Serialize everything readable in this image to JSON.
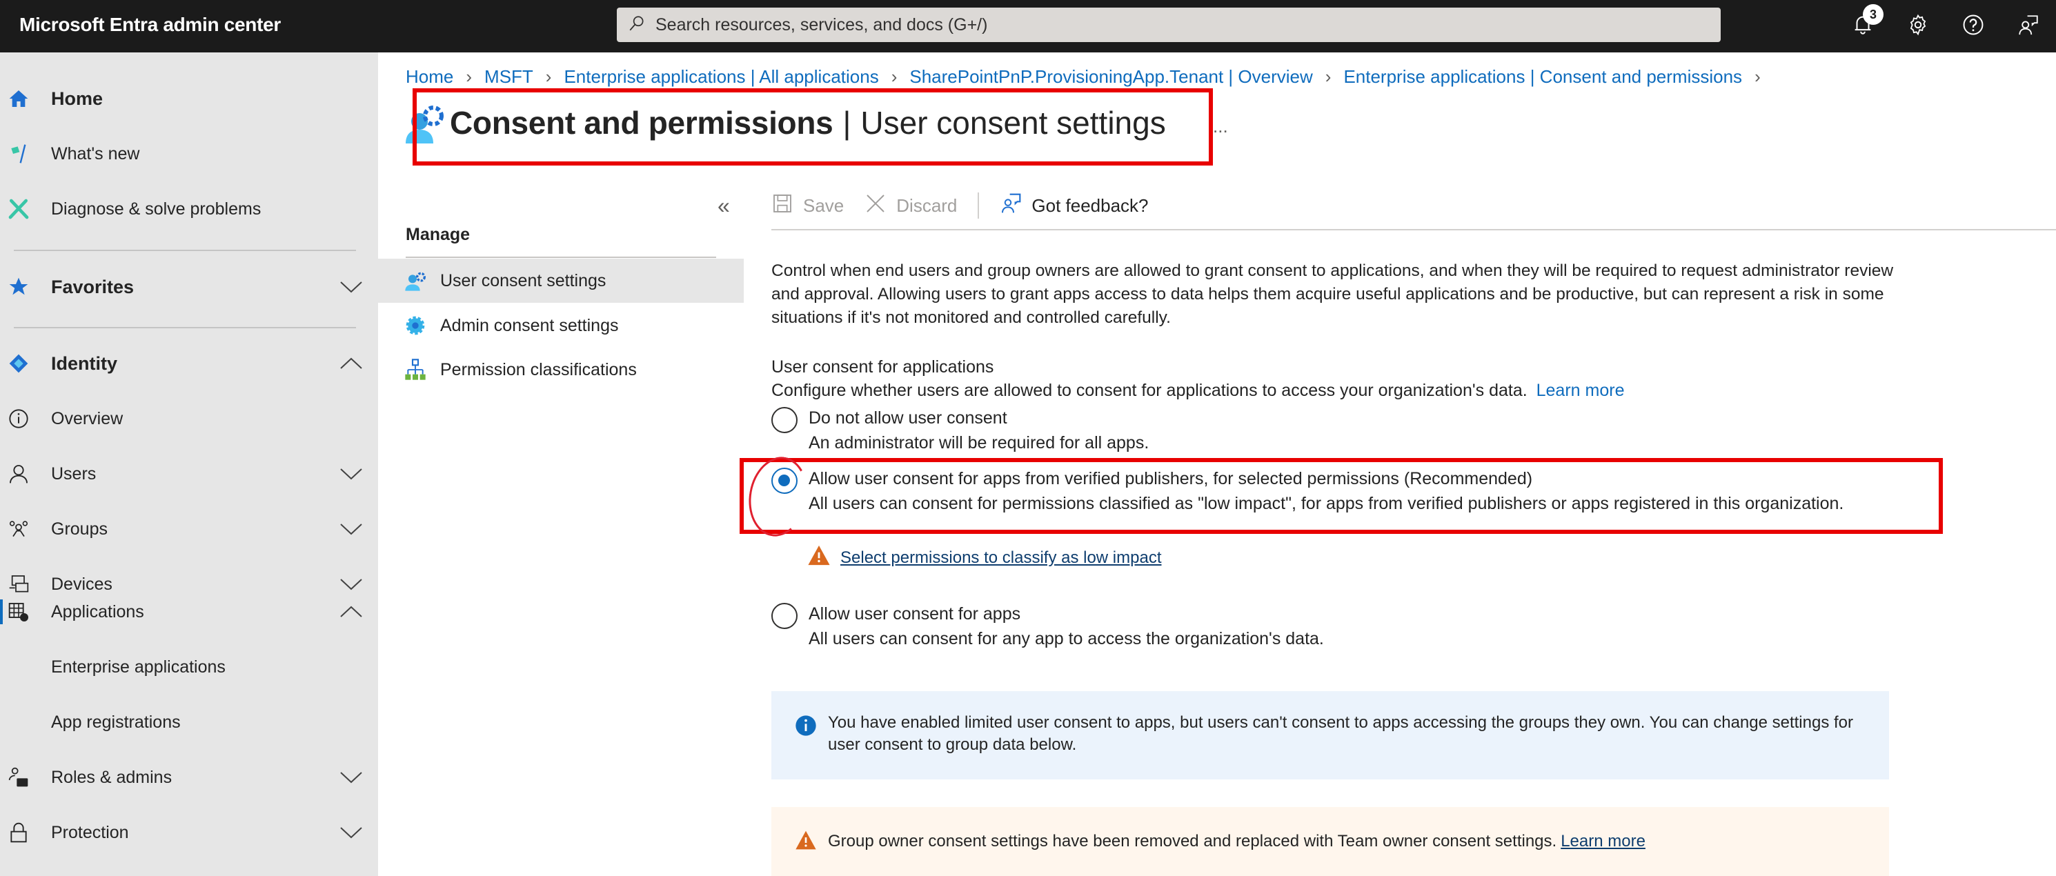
{
  "app": {
    "title": "Microsoft Entra admin center",
    "search_placeholder": "Search resources, services, and docs (G+/)",
    "notification_count": "3"
  },
  "header_icons": [
    "bell-icon",
    "gear-icon",
    "help-icon",
    "feedback-icon"
  ],
  "sidebar": {
    "items": [
      {
        "label": "Home",
        "icon": "home-icon",
        "bold": true
      },
      {
        "label": "What's new",
        "icon": "flag-icon"
      },
      {
        "label": "Diagnose & solve problems",
        "icon": "wrench-icon"
      },
      {
        "label": "Favorites",
        "icon": "star-icon",
        "bold": true,
        "expanded": false
      },
      {
        "label": "Identity",
        "icon": "identity-diamond-icon",
        "bold": true,
        "expanded": true
      },
      {
        "label": "Overview",
        "icon": "info-icon"
      },
      {
        "label": "Users",
        "icon": "user-icon",
        "expanded": false
      },
      {
        "label": "Groups",
        "icon": "groups-icon",
        "expanded": false
      },
      {
        "label": "Devices",
        "icon": "devices-icon",
        "expanded": false
      },
      {
        "label": "Applications",
        "icon": "applications-icon",
        "expanded": true,
        "active": true
      },
      {
        "label": "Enterprise applications"
      },
      {
        "label": "App registrations"
      },
      {
        "label": "Roles & admins",
        "icon": "roles-icon",
        "expanded": false
      },
      {
        "label": "Protection",
        "icon": "lock-icon",
        "expanded": false
      }
    ]
  },
  "breadcrumb": [
    "Home",
    "MSFT",
    "Enterprise applications | All applications",
    "SharePointPnP.ProvisioningApp.Tenant | Overview",
    "Enterprise applications | Consent and permissions"
  ],
  "page": {
    "title_main": "Consent and permissions",
    "title_sep": "|",
    "title_sub": "User consent settings",
    "more": "..."
  },
  "subnav": {
    "collapse": "«",
    "heading": "Manage",
    "items": [
      {
        "label": "User consent settings",
        "selected": true
      },
      {
        "label": "Admin consent settings"
      },
      {
        "label": "Permission classifications"
      }
    ]
  },
  "commands": {
    "save": "Save",
    "discard": "Discard",
    "feedback": "Got feedback?"
  },
  "content": {
    "description": "Control when end users and group owners are allowed to grant consent to applications, and when they will be required to request administrator review and approval. Allowing users to grant apps access to data helps them acquire useful applications and be productive, but can represent a risk in some situations if it's not monitored and controlled carefully.",
    "section_title": "User consent for applications",
    "section_desc": "Configure whether users are allowed to consent for applications to access your organization's data.",
    "learn_more": "Learn more",
    "options": [
      {
        "label": "Do not allow user consent",
        "sub": "An administrator will be required for all apps.",
        "checked": false
      },
      {
        "label": "Allow user consent for apps from verified publishers, for selected permissions (Recommended)",
        "sub": "All users can consent for permissions classified as \"low impact\", for apps from verified publishers or apps registered in this organization.",
        "checked": true
      },
      {
        "label": "Allow user consent for apps",
        "sub": "All users can consent for any app to access the organization's data.",
        "checked": false
      }
    ],
    "classify_link": "Select permissions to classify as low impact",
    "info_banner": "You have enabled limited user consent to apps, but users can't consent to apps accessing the groups they own. You can change settings for user consent to group data below.",
    "warning_banner": "Group owner consent settings have been removed and replaced with Team owner consent settings.",
    "warning_learn_more": "Learn more"
  },
  "colors": {
    "accent": "#0f6cbd",
    "topbar": "#1b1b1b",
    "sidebar": "#e6e6e6",
    "annotation": "#e80000",
    "info_bg": "#ebf3fc",
    "warning_bg": "#fff6ed",
    "warning_icon": "#d9691f"
  }
}
